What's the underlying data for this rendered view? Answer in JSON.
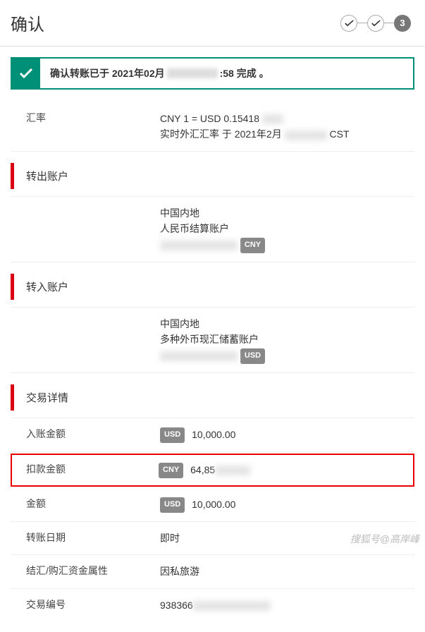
{
  "header": {
    "title": "确认",
    "step3": "3"
  },
  "alert": {
    "prefix": "确认转账已于 2021年02月",
    "suffix": ":58 完成 。"
  },
  "exchange": {
    "label": "汇率",
    "rate": "CNY 1 = USD 0.15418",
    "note_prefix": "实时外汇汇率 于 2021年2月",
    "note_suffix": "CST"
  },
  "from_account": {
    "head": "转出账户",
    "region": "中国内地",
    "type": "人民币结算账户",
    "currency": "CNY"
  },
  "to_account": {
    "head": "转入账户",
    "region": "中国内地",
    "type": "多种外币现汇储蓄账户",
    "currency": "USD"
  },
  "details": {
    "head": "交易详情",
    "credit_label": "入账金额",
    "credit_currency": "USD",
    "credit_value": "10,000.00",
    "debit_label": "扣款金额",
    "debit_currency": "CNY",
    "debit_value": "64,85",
    "amount_label": "金额",
    "amount_currency": "USD",
    "amount_value": "10,000.00",
    "date_label": "转账日期",
    "date_value": "即时",
    "purpose_label": "结汇/购汇资金属性",
    "purpose_value": "因私旅游",
    "txn_label": "交易编号",
    "txn_value": "938366"
  },
  "watermark": "搜狐号@高岸峰"
}
